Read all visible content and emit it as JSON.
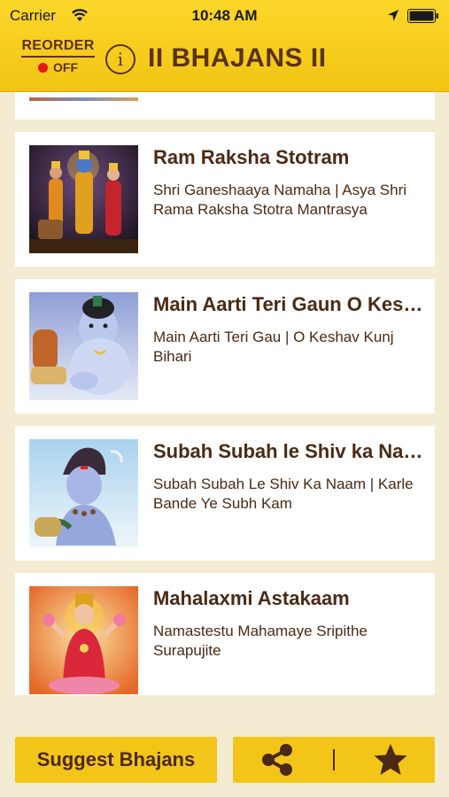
{
  "status_bar": {
    "carrier": "Carrier",
    "time": "10:48 AM",
    "icons": [
      "wifi-icon",
      "location-icon",
      "battery-icon"
    ]
  },
  "header": {
    "reorder_label": "REORDER",
    "reorder_state": "OFF",
    "info_label": "i",
    "title": "II BHAJANS II",
    "colors": {
      "bar": "#f4c519",
      "text": "#5a3213",
      "off_dot": "#e8171c"
    }
  },
  "bhajans": [
    {
      "title": "Ram Raksha Stotram",
      "subtitle": "Shri Ganeshaaya Namaha | Asya Shri Rama Raksha Stotra Mantrasya",
      "thumbnail": "ram-sita-lakshman-image"
    },
    {
      "title": "Main Aarti Teri Gaun O Keshav Kunj Bihari",
      "subtitle": "Main Aarti Teri Gau | O Keshav Kunj Bihari",
      "thumbnail": "bal-krishna-image"
    },
    {
      "title": "Subah Subah le Shiv ka Naam",
      "subtitle": "Subah Subah Le Shiv Ka Naam | Karle Bande Ye Subh Kam",
      "thumbnail": "shiva-image"
    },
    {
      "title": "Mahalaxmi Astakaam",
      "subtitle": "Namastestu Mahamaye Sripithe Surapujite",
      "thumbnail": "lakshmi-image"
    }
  ],
  "bottom_bar": {
    "suggest_label": "Suggest Bhajans",
    "icons": [
      "share-icon",
      "star-icon"
    ]
  }
}
